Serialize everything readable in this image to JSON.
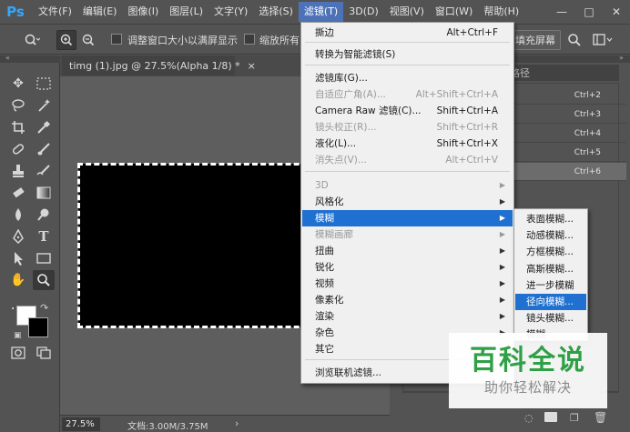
{
  "app": {
    "logo": "Ps"
  },
  "menubar": {
    "items": [
      "文件(F)",
      "编辑(E)",
      "图像(I)",
      "图层(L)",
      "文字(Y)",
      "选择(S)",
      "滤镜(T)",
      "3D(D)",
      "视图(V)",
      "窗口(W)",
      "帮助(H)"
    ],
    "active": "滤镜(T)",
    "window_controls": [
      "minimize-icon",
      "maximize-icon",
      "close-icon"
    ]
  },
  "options": {
    "resize_windows_label": "调整窗口大小以满屏显示",
    "zoom_all_label": "缩放所有",
    "fill_screen_label": "填充屏幕"
  },
  "document": {
    "tab_title": "timg (1).jpg @ 27.5%(Alpha 1/8) *",
    "close_glyph": "×",
    "zoom": "27.5%",
    "doc_size": "文档:3.00M/3.75M",
    "status_arrow": "›"
  },
  "right_panel": {
    "tab_label": "路径",
    "shortcuts": [
      "Ctrl+2",
      "Ctrl+3",
      "Ctrl+4",
      "Ctrl+5",
      "Ctrl+6"
    ]
  },
  "filter_menu": {
    "items": [
      {
        "label": "撕边",
        "shortcut": "Alt+Ctrl+F",
        "enabled": true
      },
      {
        "label": "转换为智能滤镜(S)",
        "shortcut": "",
        "enabled": true
      },
      {
        "label": "滤镜库(G)...",
        "shortcut": "",
        "enabled": true
      },
      {
        "label": "自适应广角(A)...",
        "shortcut": "Alt+Shift+Ctrl+A",
        "enabled": false
      },
      {
        "label": "Camera Raw 滤镜(C)...",
        "shortcut": "Shift+Ctrl+A",
        "enabled": true
      },
      {
        "label": "镜头校正(R)...",
        "shortcut": "Shift+Ctrl+R",
        "enabled": false
      },
      {
        "label": "液化(L)...",
        "shortcut": "Shift+Ctrl+X",
        "enabled": true
      },
      {
        "label": "消失点(V)...",
        "shortcut": "Alt+Ctrl+V",
        "enabled": false
      },
      {
        "label": "3D",
        "submenu": true,
        "enabled": false
      },
      {
        "label": "风格化",
        "submenu": true,
        "enabled": true
      },
      {
        "label": "模糊",
        "submenu": true,
        "enabled": true,
        "highlighted": true
      },
      {
        "label": "模糊画廊",
        "submenu": true,
        "enabled": false
      },
      {
        "label": "扭曲",
        "submenu": true,
        "enabled": true
      },
      {
        "label": "锐化",
        "submenu": true,
        "enabled": true
      },
      {
        "label": "视频",
        "submenu": true,
        "enabled": true
      },
      {
        "label": "像素化",
        "submenu": true,
        "enabled": true
      },
      {
        "label": "渲染",
        "submenu": true,
        "enabled": true
      },
      {
        "label": "杂色",
        "submenu": true,
        "enabled": true
      },
      {
        "label": "其它",
        "submenu": true,
        "enabled": true
      },
      {
        "label": "浏览联机滤镜...",
        "shortcut": "",
        "enabled": true
      }
    ]
  },
  "blur_submenu": {
    "items": [
      "表面模糊...",
      "动感模糊...",
      "方框模糊...",
      "高斯模糊...",
      "进一步模糊",
      "径向模糊...",
      "镜头模糊...",
      "模糊"
    ],
    "highlighted": "径向模糊..."
  },
  "watermark": {
    "title": "百科全说",
    "subtitle": "助你轻松解决"
  },
  "colors": {
    "accent": "#1f70d0",
    "menu_active": "#4d72b8",
    "watermark_green": "#2fa046"
  }
}
